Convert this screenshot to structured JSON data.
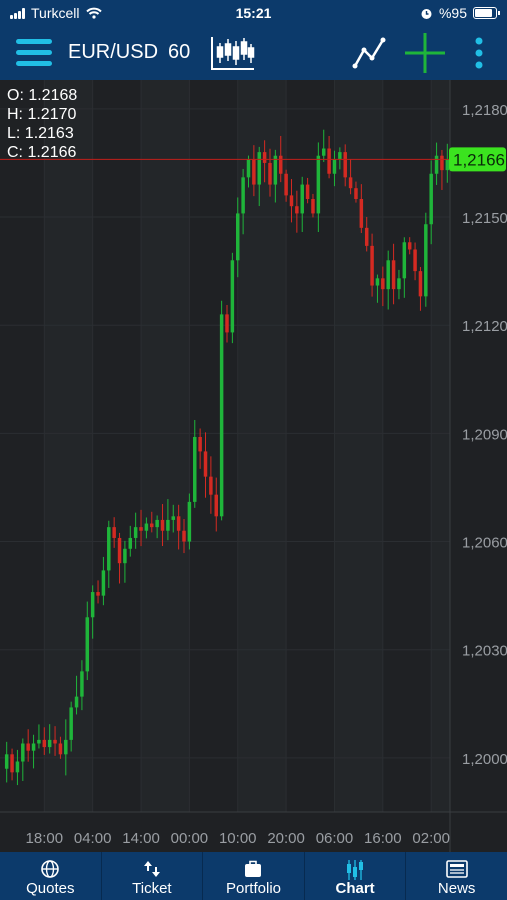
{
  "status_bar": {
    "carrier": "Turkcell",
    "time": "15:21",
    "battery": "%95",
    "battery_level": 0.95
  },
  "toolbar": {
    "symbol": "EUR/USD",
    "period": "60"
  },
  "ohlc": {
    "open": "O: 1.2168",
    "high": "H: 1.2170",
    "low": "L: 1.2163",
    "close": "C: 1.2166"
  },
  "chart_data": {
    "type": "candlestick",
    "instrument": "EUR/USD",
    "timeframe": "60",
    "ylim": [
      1.1985,
      1.2188
    ],
    "y_ticks": [
      "1,2180",
      "1,2150",
      "1,2120",
      "1,2090",
      "1,2060",
      "1,2030",
      "1,2000"
    ],
    "y_tick_values": [
      1.218,
      1.215,
      1.212,
      1.209,
      1.206,
      1.203,
      1.2
    ],
    "x_ticks": [
      "18:00",
      "04:00",
      "14:00",
      "00:00",
      "10:00",
      "20:00",
      "06:00",
      "16:00",
      "02:00"
    ],
    "x_tick_index": [
      7,
      16,
      25,
      34,
      43,
      52,
      61,
      70,
      79
    ],
    "current_price": "1,2166",
    "current_value": 1.2166,
    "closes": [
      1.2001,
      1.1996,
      1.1999,
      1.2004,
      1.2002,
      1.2004,
      1.2005,
      1.2003,
      1.2005,
      1.2004,
      1.2001,
      1.2005,
      1.2014,
      1.2017,
      1.2024,
      1.2039,
      1.2046,
      1.2045,
      1.2052,
      1.2064,
      1.2061,
      1.2054,
      1.2058,
      1.2061,
      1.2064,
      1.2063,
      1.2065,
      1.2064,
      1.2066,
      1.2063,
      1.2066,
      1.2067,
      1.2063,
      1.206,
      1.2071,
      1.2089,
      1.2085,
      1.2078,
      1.2073,
      1.2067,
      1.2123,
      1.2118,
      1.2138,
      1.2151,
      1.2161,
      1.2166,
      1.2159,
      1.2168,
      1.2165,
      1.2159,
      1.2167,
      1.2162,
      1.2156,
      1.2153,
      1.2151,
      1.2159,
      1.2155,
      1.2151,
      1.2167,
      1.2169,
      1.2162,
      1.2166,
      1.2168,
      1.2161,
      1.2158,
      1.2155,
      1.2147,
      1.2142,
      1.2131,
      1.2133,
      1.213,
      1.2138,
      1.213,
      1.2133,
      1.2143,
      1.2141,
      1.2135,
      1.2128,
      1.2148,
      1.2162,
      1.2167,
      1.2163,
      1.2166
    ]
  },
  "tabs": [
    {
      "label": "Quotes",
      "icon": "globe-icon",
      "active": false
    },
    {
      "label": "Ticket",
      "icon": "up-down-arrows-icon",
      "active": false
    },
    {
      "label": "Portfolio",
      "icon": "briefcase-icon",
      "active": false
    },
    {
      "label": "Chart",
      "icon": "candlestick-icon",
      "active": true
    },
    {
      "label": "News",
      "icon": "newspaper-icon",
      "active": false
    }
  ],
  "colors": {
    "bar": "#0c3a6b",
    "accent": "#21bfe6",
    "up": "#1fb53a",
    "down": "#d42a22",
    "price_label": "#3be31f",
    "grid": "#2b2e32"
  }
}
